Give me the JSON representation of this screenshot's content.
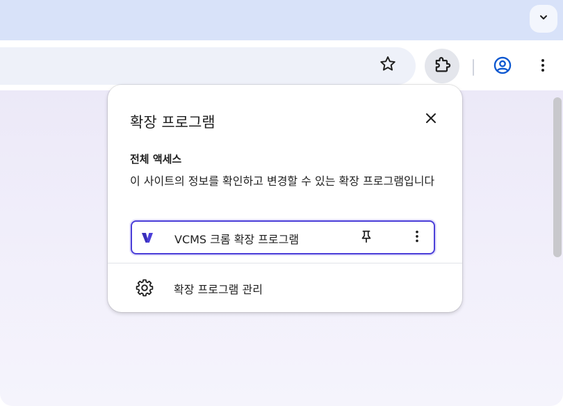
{
  "browser": {
    "icons": {
      "tab_search": "chevron-down-icon",
      "bookmark": "star-icon",
      "extensions": "puzzle-icon",
      "profile": "account-circle-icon",
      "menu": "more-vert-icon"
    }
  },
  "extensions_popup": {
    "title": "확장 프로그램",
    "close_icon": "close-icon",
    "full_access": {
      "heading": "전체 액세스",
      "description": "이 사이트의 정보를 확인하고 변경할 수 있는 확장 프로그램입니다"
    },
    "extensions": [
      {
        "name": "VCMS 크롬 확장 프로그램",
        "logo": "vcms-logo-icon",
        "pin_icon": "pin-icon",
        "more_icon": "more-vert-icon"
      }
    ],
    "manage": {
      "label": "확장 프로그램 관리",
      "icon": "gear-icon"
    }
  },
  "colors": {
    "accent": "#4b3fd8",
    "profile_blue": "#0b57d0",
    "tabstrip": "#d8e2f9",
    "page_background": "#ece9f8"
  }
}
